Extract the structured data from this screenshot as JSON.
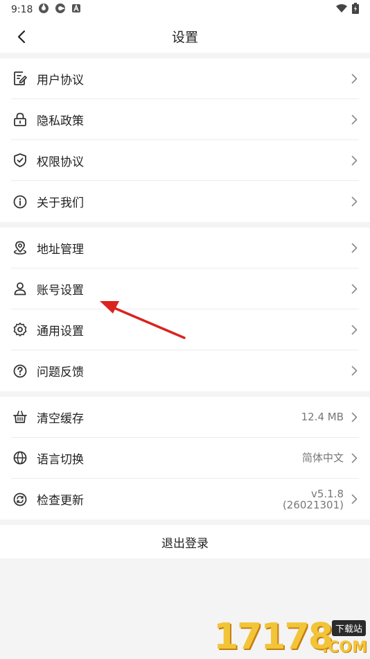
{
  "status_bar": {
    "time": "9:18"
  },
  "nav": {
    "title": "设置"
  },
  "groups": [
    {
      "items": [
        {
          "label": "用户协议",
          "icon": "document-edit-icon"
        },
        {
          "label": "隐私政策",
          "icon": "lock-icon"
        },
        {
          "label": "权限协议",
          "icon": "shield-check-icon"
        },
        {
          "label": "关于我们",
          "icon": "info-icon"
        }
      ]
    },
    {
      "items": [
        {
          "label": "地址管理",
          "icon": "location-pin-icon"
        },
        {
          "label": "账号设置",
          "icon": "user-icon"
        },
        {
          "label": "通用设置",
          "icon": "gear-icon"
        },
        {
          "label": "问题反馈",
          "icon": "question-icon"
        }
      ]
    },
    {
      "items": [
        {
          "label": "清空缓存",
          "icon": "basket-icon",
          "value": "12.4 MB"
        },
        {
          "label": "语言切换",
          "icon": "globe-icon",
          "value": "简体中文"
        },
        {
          "label": "检查更新",
          "icon": "refresh-icon",
          "value": "v5.1.8",
          "value2": "(26021301)"
        }
      ]
    }
  ],
  "logout": {
    "label": "退出登录"
  },
  "watermark": {
    "number": "17178",
    "tag": "下载站",
    "suffix": ".COM"
  },
  "colors": {
    "annotation_arrow": "#d9241f",
    "background": "#f4f4f4",
    "watermark": "#f2c437"
  }
}
